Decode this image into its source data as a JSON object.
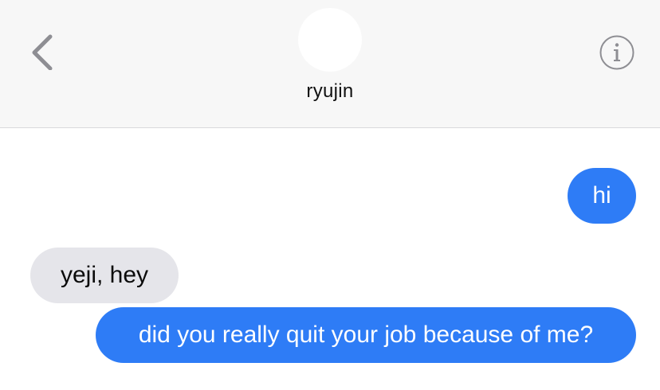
{
  "header": {
    "contact_name": "ryujin",
    "back_icon": "chevron-left-icon",
    "info_icon": "info-icon"
  },
  "colors": {
    "header_bg": "#f7f7f7",
    "outgoing_bubble": "#2e7cf6",
    "incoming_bubble": "#e5e5ea",
    "icon_gray": "#8e8e93"
  },
  "messages": [
    {
      "direction": "outgoing",
      "text": "hi"
    },
    {
      "direction": "incoming",
      "text": "yeji, hey"
    },
    {
      "direction": "outgoing",
      "text": "did you really quit your job because of me?"
    }
  ]
}
